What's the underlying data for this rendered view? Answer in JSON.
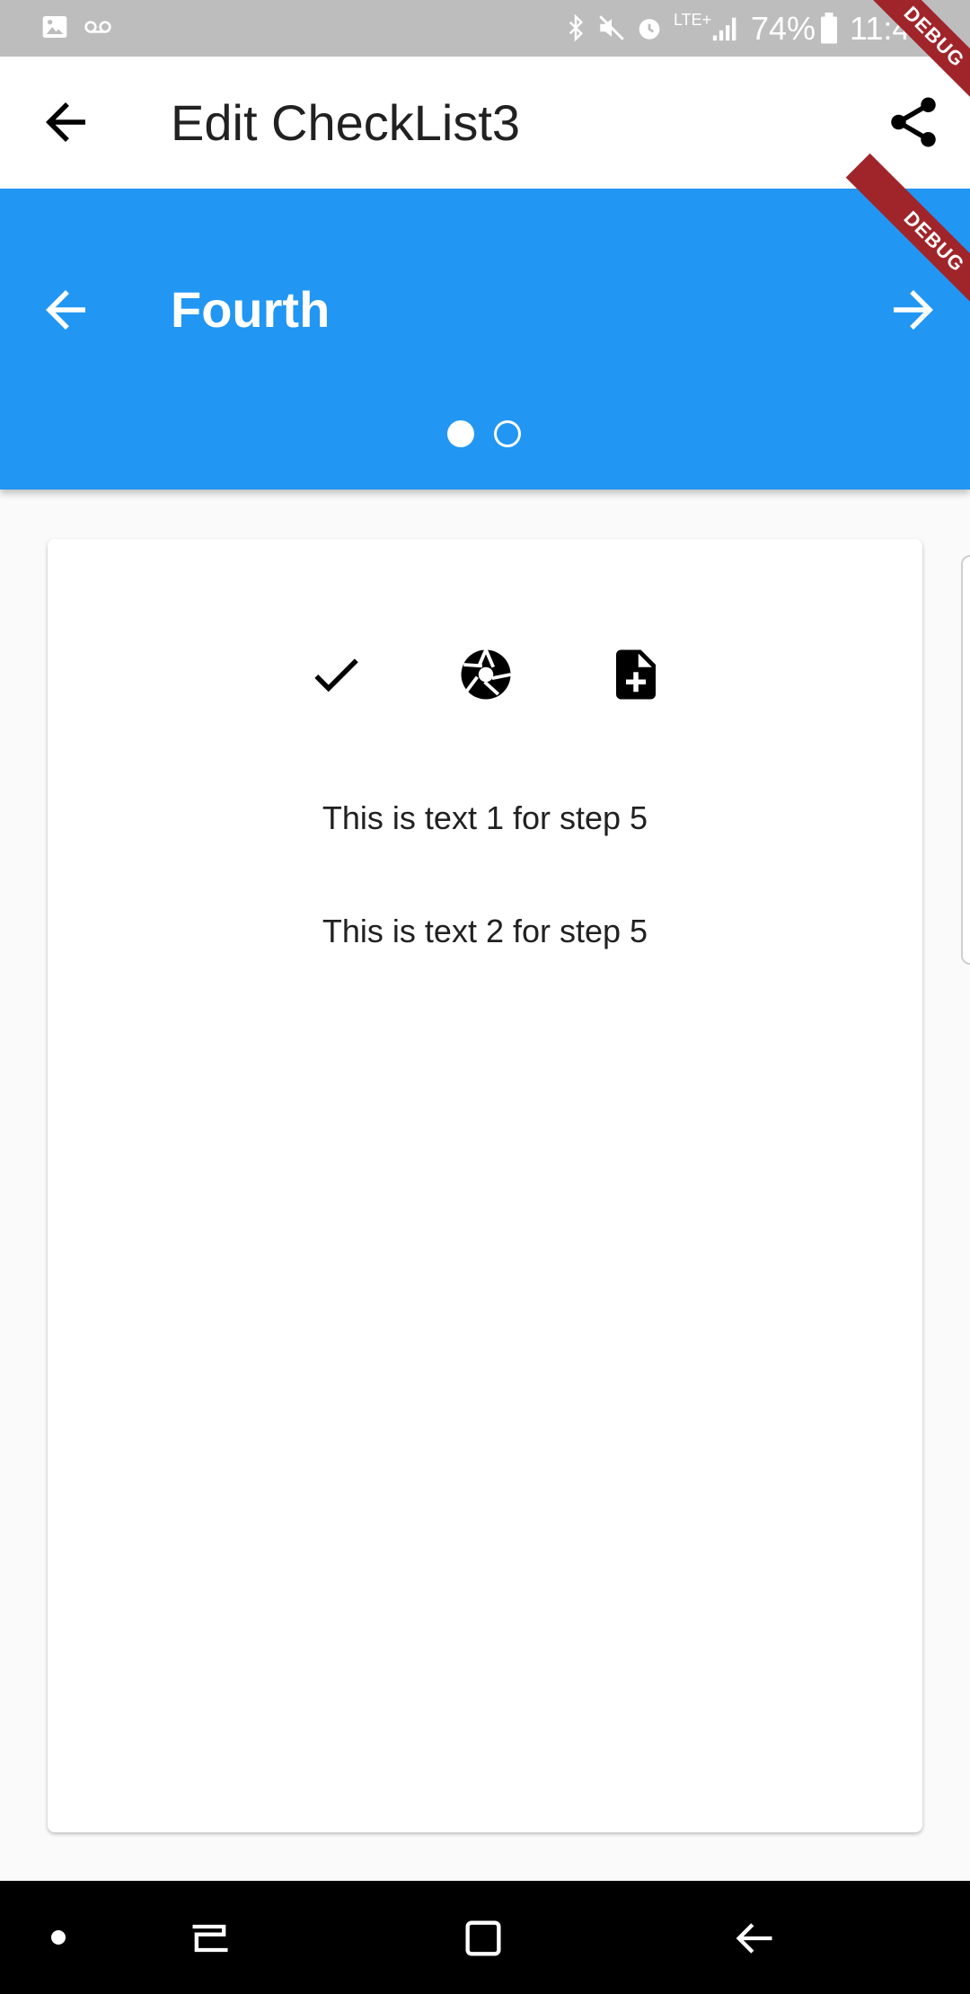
{
  "status_bar": {
    "battery": "74%",
    "time": "11:40",
    "network": "LTE+"
  },
  "app_bar": {
    "title": "Edit CheckList3"
  },
  "step_header": {
    "title": "Fourth",
    "page_count": 2,
    "active_page": 1
  },
  "card": {
    "text_1": "This is text 1 for step 5",
    "text_2": "This is text 2 for step 5"
  },
  "debug_banner": "DEBUG",
  "colors": {
    "primary": "#2196f3",
    "status_bar": "#bdbdbd",
    "debug_ribbon": "#a0252b"
  },
  "icons": {
    "back": "arrow-back-icon",
    "share": "share-icon",
    "prev_step": "arrow-back-icon",
    "next_step": "arrow-forward-icon",
    "done": "check-icon",
    "camera": "camera-shutter-icon",
    "add_note": "note-add-icon"
  }
}
